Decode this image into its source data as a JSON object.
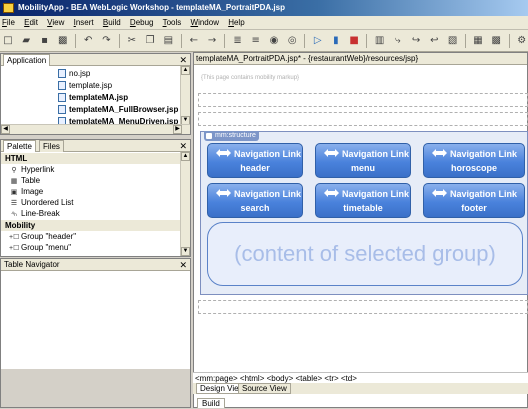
{
  "window": {
    "title": "MobilityApp - BEA WebLogic Workshop - templateMA_PortraitPDA.jsp"
  },
  "menu": {
    "items": [
      {
        "u": "F",
        "rest": "ile"
      },
      {
        "u": "E",
        "rest": "dit"
      },
      {
        "u": "V",
        "rest": "iew"
      },
      {
        "u": "I",
        "rest": "nsert"
      },
      {
        "u": "B",
        "rest": "uild"
      },
      {
        "u": "D",
        "rest": "ebug"
      },
      {
        "u": "T",
        "rest": "ools"
      },
      {
        "u": "W",
        "rest": "indow"
      },
      {
        "u": "H",
        "rest": "elp"
      }
    ]
  },
  "application_panel": {
    "tab": "Application",
    "files": [
      "no.jsp",
      "template.jsp",
      "templateMA.jsp",
      "templateMA_FullBrowser.jsp",
      "templateMA_MenuDriven.jsp"
    ]
  },
  "palette_panel": {
    "tabs": [
      "Palette",
      "Files"
    ],
    "sections": [
      {
        "header": "HTML",
        "items": [
          {
            "icon": "hyperlink-icon",
            "glyph": "⚲",
            "label": "Hyperlink"
          },
          {
            "icon": "table-icon",
            "glyph": "▦",
            "label": "Table"
          },
          {
            "icon": "image-icon",
            "glyph": "▣",
            "label": "Image"
          },
          {
            "icon": "unordered-list-icon",
            "glyph": "☰",
            "label": "Unordered List"
          },
          {
            "icon": "line-break-icon",
            "glyph": "⁴ₕ",
            "label": "Line-Break"
          }
        ]
      },
      {
        "header": "Mobility",
        "items": [
          {
            "icon": "group-icon",
            "glyph": "+☐",
            "label": "Group \"header\""
          },
          {
            "icon": "group-icon",
            "glyph": "+☐",
            "label": "Group \"menu\""
          }
        ]
      }
    ]
  },
  "table_navigator": {
    "title": "Table Navigator"
  },
  "editor": {
    "tab": "templateMA_PortraitPDA.jsp* - {restaurantWeb}/resources/jsp}",
    "placeholder": "{This page contains mobility markup}",
    "structure_label": "mm:structure",
    "nav_link_label": "Navigation Link",
    "nav_links": [
      "header",
      "menu",
      "horoscope",
      "search",
      "timetable",
      "footer"
    ],
    "content_text": "(content of selected group)",
    "tag_path": "<mm:page> <html> <body> <table> <tr> <td>",
    "view_tabs": [
      "Design View",
      "Source View"
    ]
  },
  "bottom": {
    "build_tab": "Build"
  }
}
